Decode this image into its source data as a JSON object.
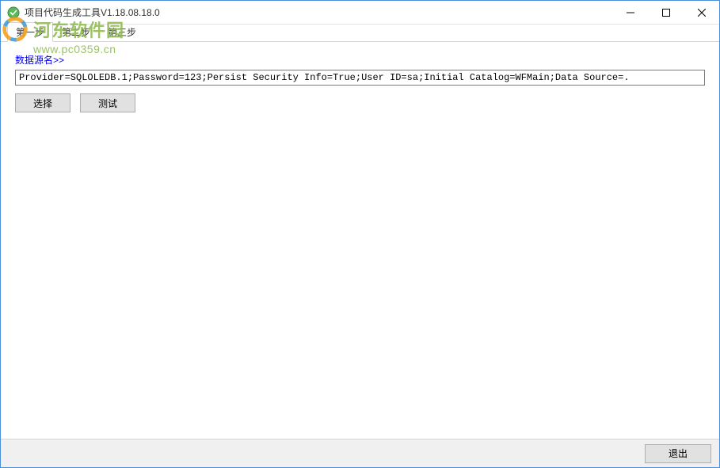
{
  "window": {
    "title": "项目代码生成工具V1.18.08.18.0"
  },
  "tabs": [
    {
      "label": "第一步",
      "active": true
    },
    {
      "label": "第二步",
      "active": false
    },
    {
      "label": "第三步",
      "active": false
    }
  ],
  "panel": {
    "link_label": "数据源名>>",
    "connection_string": "Provider=SQLOLEDB.1;Password=123;Persist Security Info=True;User ID=sa;Initial Catalog=WFMain;Data Source=.",
    "select_btn": "选择",
    "test_btn": "测试"
  },
  "footer": {
    "exit_btn": "退出"
  },
  "watermark": {
    "text": "河东软件园",
    "url": "www.pc0359.cn"
  }
}
